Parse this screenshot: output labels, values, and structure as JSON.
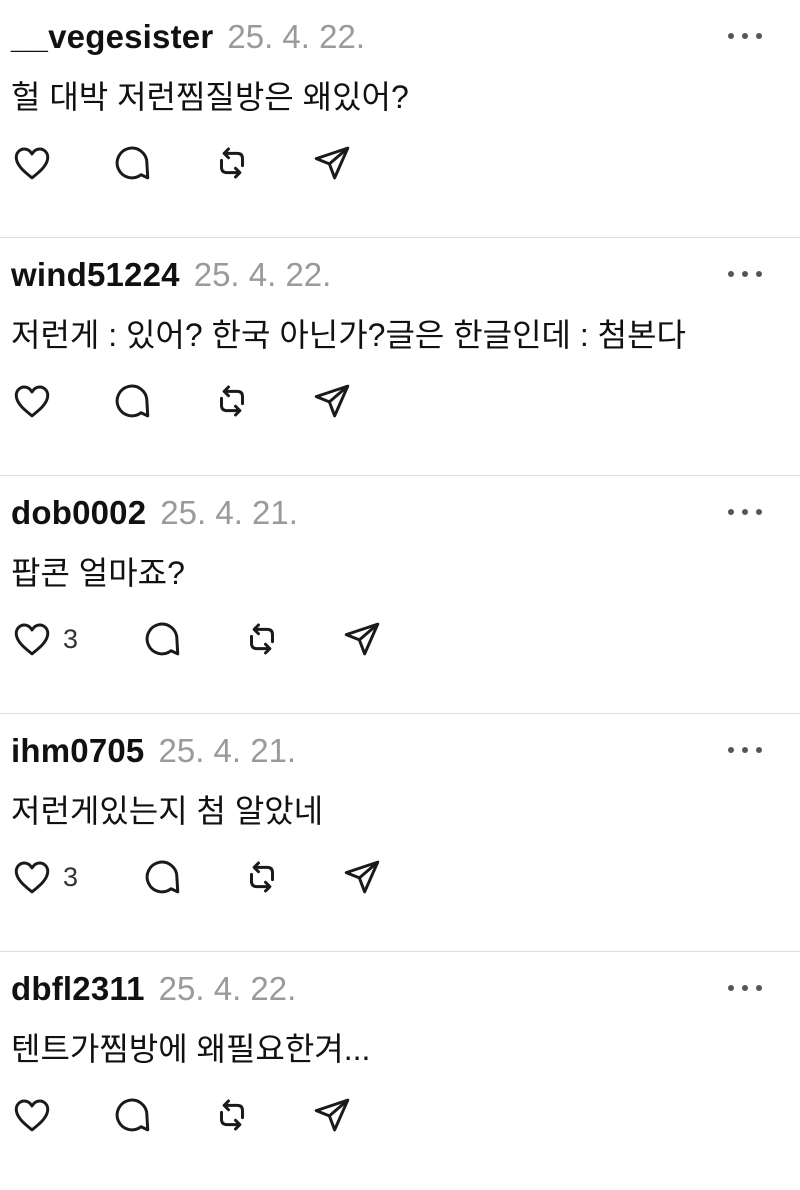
{
  "comments": [
    {
      "username": "__vegesister",
      "date": "25. 4. 22.",
      "text": "헐 대박 저런찜질방은 왜있어?",
      "likes": ""
    },
    {
      "username": "wind51224",
      "date": "25. 4. 22.",
      "text": "저런게 : 있어? 한국 아닌가?글은 한글인데 : 첨본다",
      "likes": ""
    },
    {
      "username": "dob0002",
      "date": "25. 4. 21.",
      "text": "팝콘 얼마죠?",
      "likes": "3"
    },
    {
      "username": "ihm0705",
      "date": "25. 4. 21.",
      "text": "저런게있는지 첨 알았네",
      "likes": "3"
    },
    {
      "username": "dbfl2311",
      "date": "25. 4. 22.",
      "text": "텐트가찜방에 왜필요한겨...",
      "likes": ""
    }
  ],
  "icons": {
    "like": "heart-icon",
    "reply": "speech-bubble-icon",
    "repost": "repost-icon",
    "share": "paper-plane-icon",
    "more": "more-horizontal-icon"
  },
  "colors": {
    "text": "#111111",
    "date": "#9a9a9a",
    "divider": "#dddddd",
    "icon": "#1a1a1a"
  }
}
